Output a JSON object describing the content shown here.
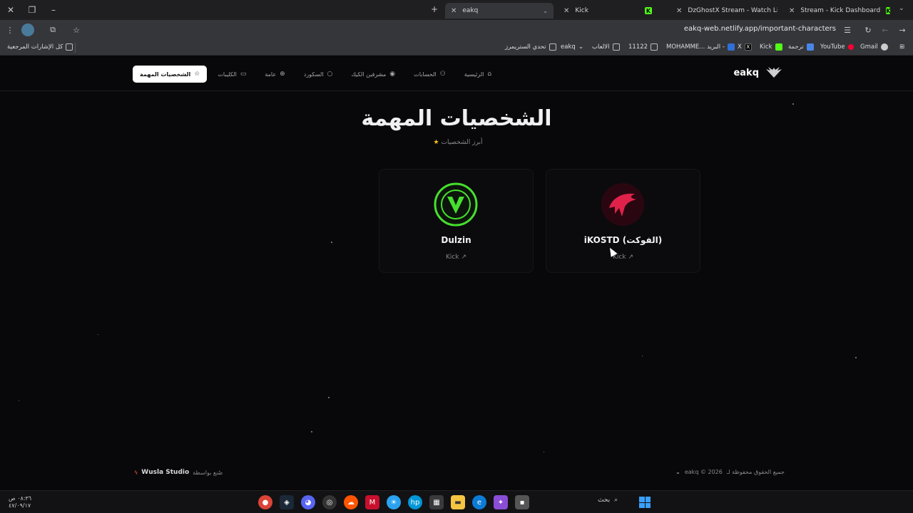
{
  "browser": {
    "tabs": [
      {
        "title": "eakq",
        "active": true
      },
      {
        "title": "Kick",
        "active": false
      },
      {
        "title": "DzGhostX Stream - Watch Live",
        "active": false
      },
      {
        "title": "Stream - Kick Dashboard",
        "active": false
      }
    ],
    "url": "eakq-web.netlify.app/important-characters",
    "bookmarks": {
      "all_bookmarks": "كل الإشارات المرجعية",
      "items": [
        "تحدي الستريمرز",
        "eakq",
        "الالعاب",
        "11122",
        "MOHAMME... البريد -",
        "X",
        "Kick",
        "ترجمة",
        "YouTube",
        "Gmail"
      ]
    }
  },
  "site": {
    "logo_text": "eakq",
    "nav": [
      {
        "label": "الرئيسية",
        "icon": "home-icon",
        "active": false
      },
      {
        "label": "الحسابات",
        "icon": "users-icon",
        "active": false
      },
      {
        "label": "مشرفين الكيك",
        "icon": "broadcast-icon",
        "active": false
      },
      {
        "label": "السكورد",
        "icon": "chat-icon",
        "active": false
      },
      {
        "label": "عامة",
        "icon": "globe-icon",
        "active": false
      },
      {
        "label": "الكليبات",
        "icon": "clip-icon",
        "active": false
      },
      {
        "label": "الشخصيات المهمة",
        "icon": "star-icon",
        "active": true
      }
    ],
    "page_title": "الشخصيات المهمة",
    "subtitle": "أبرز الشخصيات",
    "cards": [
      {
        "name": "Dulzin",
        "link": "Kick"
      },
      {
        "name": "iKOSTD (الفوكت)",
        "link": "Kick"
      }
    ],
    "footer": {
      "made_by": "صُنع بواسطة",
      "studio": "Wusla Studio",
      "rights": "جميع الحقوق محفوظة لـ",
      "copyright": "eakq © 2026"
    }
  },
  "taskbar": {
    "time": "٠٨:٣٦ ص",
    "date": "٤٧/٠٩/١٧",
    "search_label": "بحث"
  }
}
